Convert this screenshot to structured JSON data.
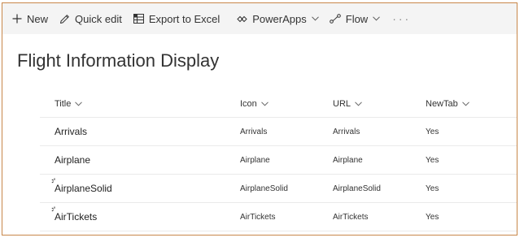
{
  "toolbar": {
    "new_label": "New",
    "quick_edit_label": "Quick edit",
    "export_label": "Export to Excel",
    "powerapps_label": "PowerApps",
    "flow_label": "Flow",
    "more_label": "···"
  },
  "page": {
    "title": "Flight Information Display"
  },
  "columns": {
    "title": "Title",
    "icon": "Icon",
    "url": "URL",
    "newtab": "NewTab"
  },
  "rows": [
    {
      "title": "Arrivals",
      "icon": "Arrivals",
      "url": "Arrivals",
      "newtab": "Yes",
      "is_new": false
    },
    {
      "title": "Airplane",
      "icon": "Airplane",
      "url": "Airplane",
      "newtab": "Yes",
      "is_new": false
    },
    {
      "title": "AirplaneSolid",
      "icon": "AirplaneSolid",
      "url": "AirplaneSolid",
      "newtab": "Yes",
      "is_new": true
    },
    {
      "title": "AirTickets",
      "icon": "AirTickets",
      "url": "AirTickets",
      "newtab": "Yes",
      "is_new": true
    }
  ],
  "colors": {
    "frame_border": "#c8874a",
    "command_bar": "#f4f4f4",
    "row_divider": "#eaeaea",
    "new_indicator": "#333333"
  },
  "icons": {
    "new": "plus-icon",
    "quick_edit": "pencil-icon",
    "export": "excel-grid-icon",
    "powerapps": "powerapps-icon",
    "flow": "flow-icon",
    "dropdown": "chevron-down-icon",
    "new_item": "new-item-sparkle-icon"
  }
}
